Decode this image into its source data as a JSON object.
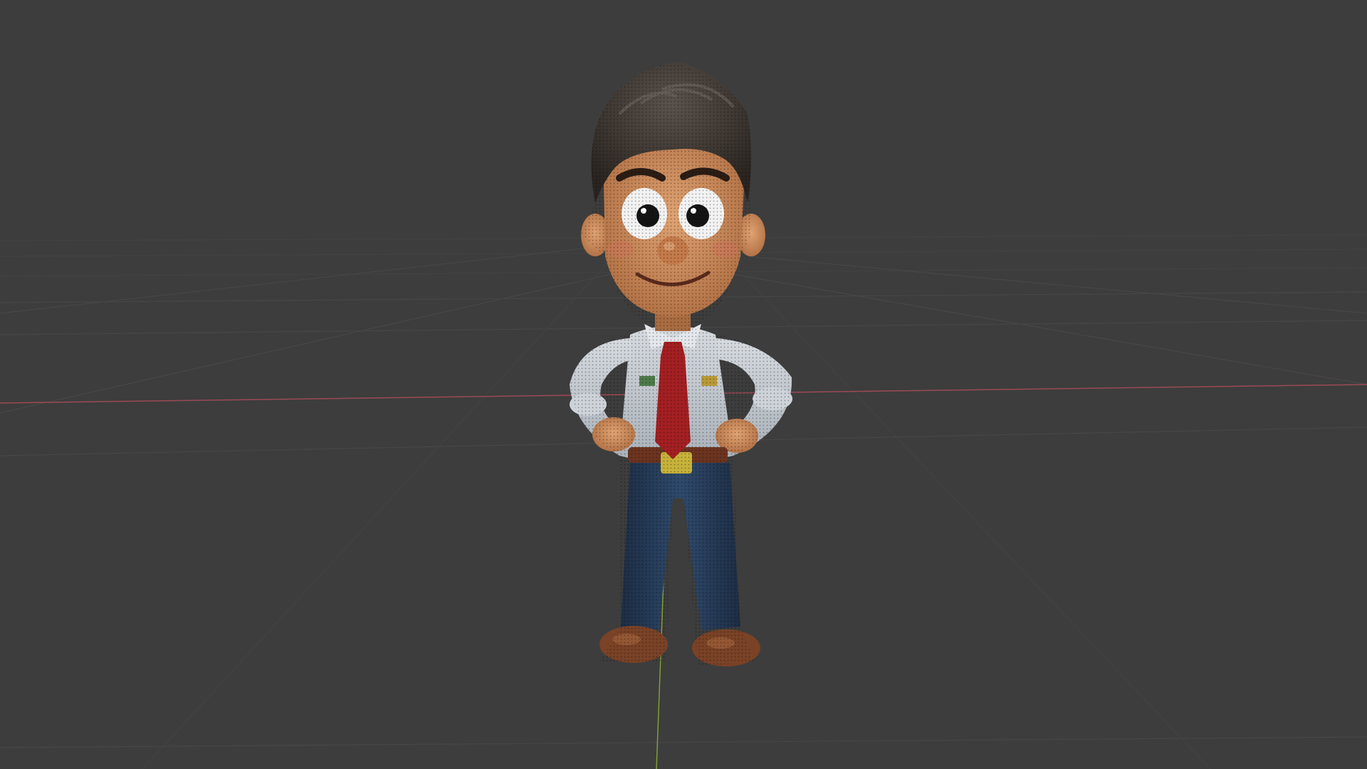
{
  "viewport": {
    "background": "#3d3d3d",
    "grid_color": "#474747",
    "x_axis_color": "#9b4a56",
    "y_axis_color": "#7f9f35"
  },
  "model": {
    "subject": "3d-cartoon-character",
    "colors": {
      "hair": "#3b3430",
      "skin": "#c98a5a",
      "shirt": "#c9cfd4",
      "tie": "#a31f22",
      "belt": "#6b3420",
      "buckle": "#c7b23a",
      "jeans": "#263a56",
      "shoes": "#7a4226"
    }
  }
}
